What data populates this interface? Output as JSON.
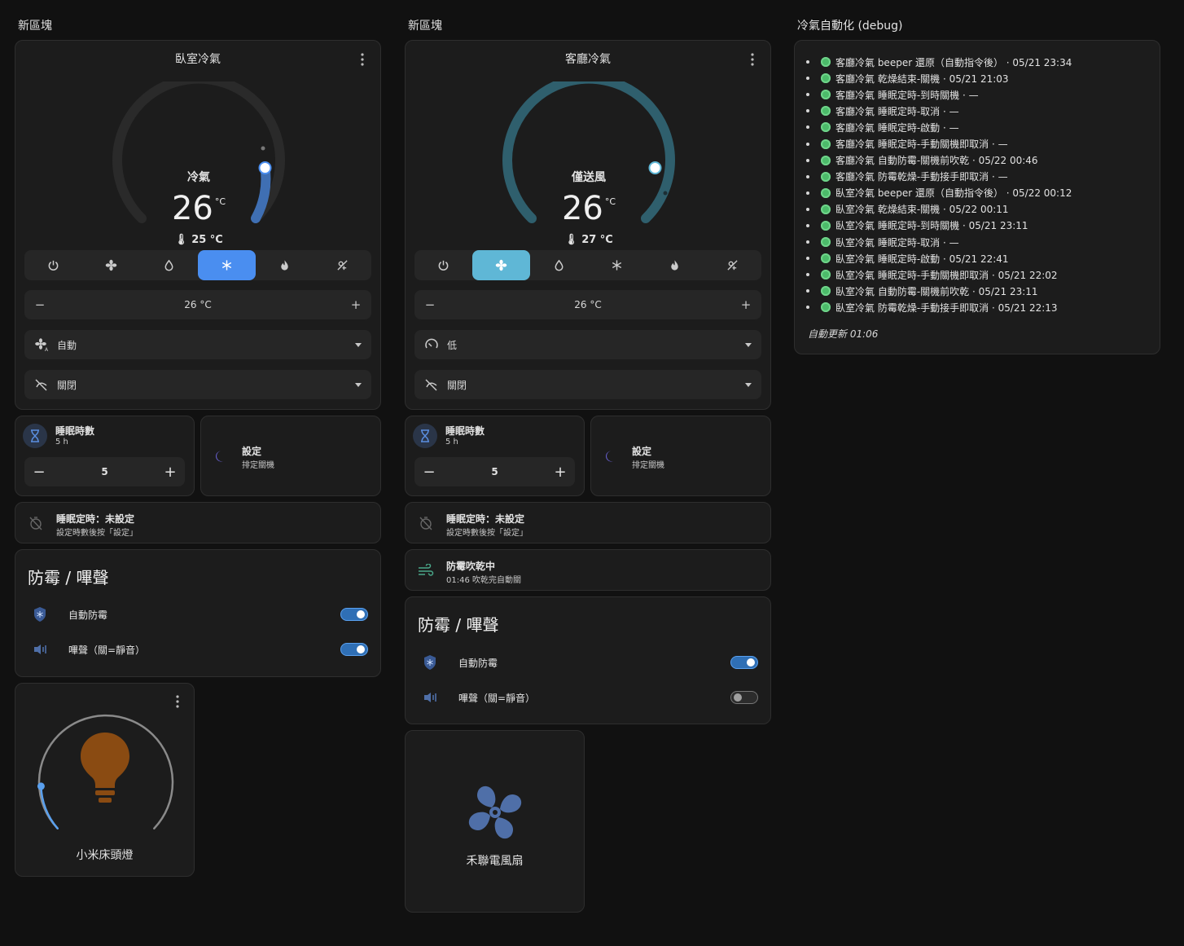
{
  "columns": {
    "col1_title": "新區塊",
    "col2_title": "新區塊",
    "col3_title": "冷氣自動化 (debug)"
  },
  "bedroom_ac": {
    "title": "臥室冷氣",
    "mode_label": "冷氣",
    "target": "26",
    "unit": "°C",
    "current": "25 °C",
    "active_mode": "cool",
    "setpoint": "26 °C",
    "fan_mode": "自動",
    "swing_mode": "關閉",
    "accent": "#3f6fb3"
  },
  "living_ac": {
    "title": "客廳冷氣",
    "mode_label": "僅送風",
    "target": "26",
    "unit": "°C",
    "current": "27 °C",
    "active_mode": "fan_only",
    "setpoint": "26 °C",
    "fan_mode": "低",
    "swing_mode": "關閉",
    "accent": "#2f5f6d"
  },
  "bedroom_sleep": {
    "name": "睡眠時數",
    "sub": "5 h",
    "value": "5",
    "set_title": "設定",
    "set_sub": "排定關機",
    "timer_title": "睡眠定時：未設定",
    "timer_sub": "設定時數後按「設定」"
  },
  "living_sleep": {
    "name": "睡眠時數",
    "sub": "5 h",
    "value": "5",
    "set_title": "設定",
    "set_sub": "排定關機",
    "timer_title": "睡眠定時：未設定",
    "timer_sub": "設定時數後按「設定」"
  },
  "living_drying": {
    "title": "防霉吹乾中",
    "sub": "01:46 吹乾完自動關"
  },
  "bedroom_mold": {
    "title": "防霉 / 嗶聲",
    "auto_label": "自動防霉",
    "auto_on": true,
    "beep_label": "嗶聲（關=靜音）",
    "beep_on": true
  },
  "living_mold": {
    "title": "防霉 / 嗶聲",
    "auto_label": "自動防霉",
    "auto_on": true,
    "beep_label": "嗶聲（關=靜音）",
    "beep_on": false
  },
  "lamp": {
    "name": "小米床頭燈",
    "brightness_pct": 1,
    "color": "#8a4b12"
  },
  "fan": {
    "name": "禾聯電風扇",
    "color": "#4f6fa8"
  },
  "debug": {
    "items": [
      "客廳冷氣 beeper 還原（自動指令後） · 05/21 23:34",
      "客廳冷氣 乾燥結束-關機 · 05/21 21:03",
      "客廳冷氣 睡眠定時-到時關機 · —",
      "客廳冷氣 睡眠定時-取消 · —",
      "客廳冷氣 睡眠定時-啟動 · —",
      "客廳冷氣 睡眠定時-手動關機即取消 · —",
      "客廳冷氣 自動防霉-關機前吹乾 · 05/22 00:46",
      "客廳冷氣 防霉乾燥-手動接手即取消 · —",
      "臥室冷氣 beeper 還原（自動指令後） · 05/22 00:12",
      "臥室冷氣 乾燥結束-關機 · 05/22 00:11",
      "臥室冷氣 睡眠定時-到時關機 · 05/21 23:11",
      "臥室冷氣 睡眠定時-取消 · —",
      "臥室冷氣 睡眠定時-啟動 · 05/21 22:41",
      "臥室冷氣 睡眠定時-手動關機即取消 · 05/21 22:02",
      "臥室冷氣 自動防霉-關機前吹乾 · 05/21 23:11",
      "臥室冷氣 防霉乾燥-手動接手即取消 · 05/21 22:13"
    ],
    "updated": "自動更新 01:06"
  }
}
